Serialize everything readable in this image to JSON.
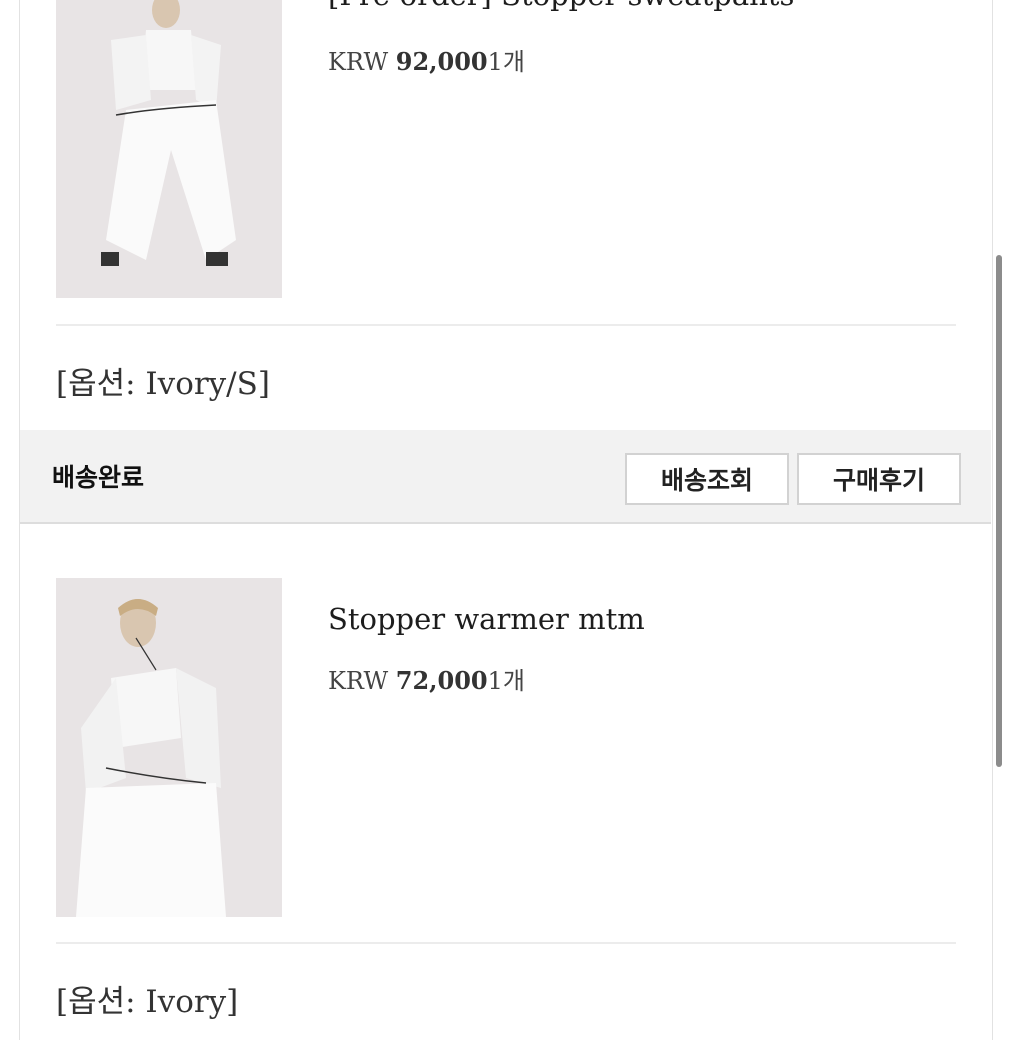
{
  "orders": [
    {
      "product_name": "[Pre-order] Stopper sweatpants",
      "currency": "KRW",
      "amount": "92,000",
      "quantity": "1개",
      "option": "[옵션: Ivory/S]"
    },
    {
      "product_name": "Stopper warmer mtm",
      "currency": "KRW",
      "amount": "72,000",
      "quantity": "1개",
      "option": "[옵션: Ivory]"
    }
  ],
  "status_bar": {
    "status": "배송완료",
    "track_button": "배송조회",
    "review_button": "구매후기"
  },
  "colors": {
    "background": "#ffffff",
    "status_bar_bg": "#f2f2f2",
    "text": "#222222",
    "divider": "#ececec"
  }
}
